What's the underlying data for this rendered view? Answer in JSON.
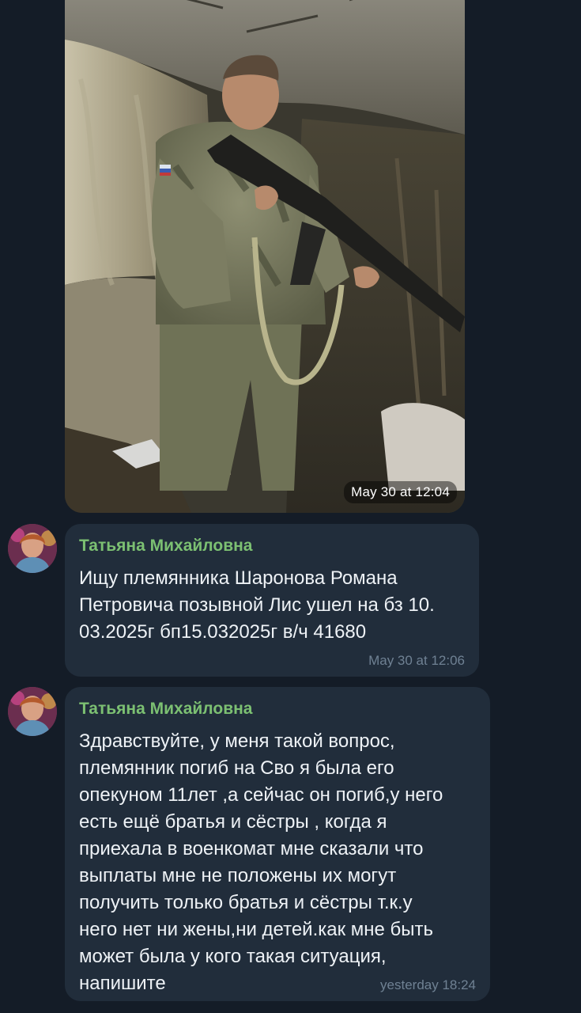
{
  "photo_message": {
    "time": "May 30 at 12:04"
  },
  "messages": [
    {
      "sender": "Татьяна Михайловна",
      "text": "Ищу племянника Шаронова Романа\nПетровича позывной Лис ушел на бз 10.\n03.2025г бп15.032025г в/ч 41680",
      "time": "May 30 at 12:06"
    },
    {
      "sender": "Татьяна Михайловна",
      "text": "Здравствуйте, у меня такой вопрос,\nплемянник погиб на Сво я была его\nопекуном 11лет ,а сейчас он погиб,у него\nесть ещё братья и сёстры , когда я\nприехала в военкомат мне сказали что\nвыплаты мне не положены их могут\nполучить только братья и сёстры т.к.у\nнего нет ни жены,ни детей.как мне быть\nможет была у кого такая ситуация,\nнапишите",
      "time": "yesterday 18:24"
    }
  ],
  "colors": {
    "background": "#141c27",
    "bubble": "#212d3b",
    "sender_name": "#7cc072",
    "timestamp": "#6f8193",
    "message_text": "#eef2f6"
  },
  "icons": {
    "avatar": "user-avatar-photo"
  }
}
